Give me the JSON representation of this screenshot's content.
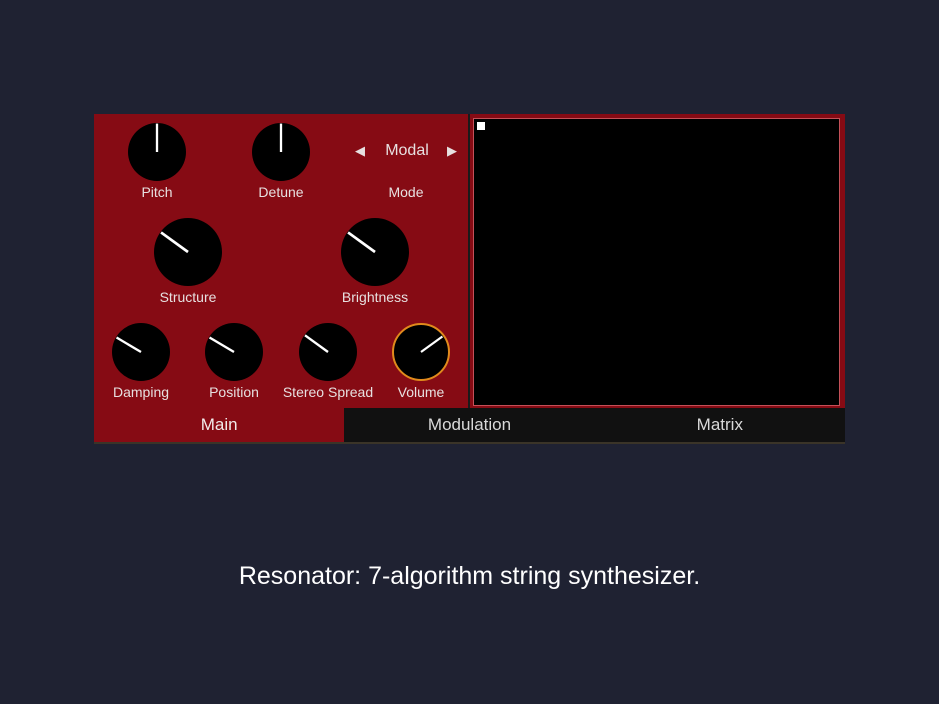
{
  "plugin": {
    "knobs_row1": [
      {
        "name": "pitch",
        "label": "Pitch",
        "value": 0.5
      },
      {
        "name": "detune",
        "label": "Detune",
        "value": 0.5
      }
    ],
    "mode": {
      "label": "Mode",
      "value": "Modal",
      "prev_icon": "triangle-left-icon",
      "next_icon": "triangle-right-icon"
    },
    "knobs_row2": [
      {
        "name": "structure",
        "label": "Structure",
        "value": 0.3
      },
      {
        "name": "brightness",
        "label": "Brightness",
        "value": 0.3
      }
    ],
    "knobs_row3": [
      {
        "name": "damping",
        "label": "Damping",
        "value": 0.28
      },
      {
        "name": "position",
        "label": "Position",
        "value": 0.28
      },
      {
        "name": "stereo-spread",
        "label": "Stereo Spread",
        "value": 0.3
      },
      {
        "name": "volume",
        "label": "Volume",
        "value": 0.7
      }
    ],
    "tabs": [
      {
        "label": "Main",
        "active": true
      },
      {
        "label": "Modulation",
        "active": false
      },
      {
        "label": "Matrix",
        "active": false
      }
    ],
    "colors": {
      "panel": "#860b14",
      "background": "#1f2232",
      "volume_ring": "#e08a1c",
      "screen": "#000000"
    }
  },
  "caption": "Resonator: 7-algorithm string synthesizer."
}
